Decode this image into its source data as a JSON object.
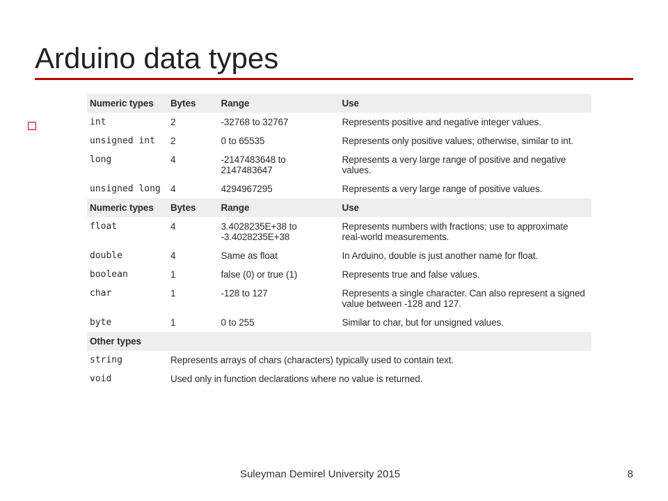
{
  "title": "Arduino data types",
  "headers1": {
    "c1": "Numeric types",
    "c2": "Bytes",
    "c3": "Range",
    "c4": "Use"
  },
  "rows1": [
    {
      "type": "int",
      "bytes": "2",
      "range": "-32768 to 32767",
      "use": "Represents positive and negative integer values."
    },
    {
      "type": "unsigned int",
      "bytes": "2",
      "range": "0 to 65535",
      "use": "Represents only positive values; otherwise, similar to int."
    },
    {
      "type": "long",
      "bytes": "4",
      "range": "-2147483648 to 2147483647",
      "use": "Represents a very large range of positive and negative values."
    },
    {
      "type": "unsigned long",
      "bytes": "4",
      "range": "4294967295",
      "use": "Represents a very large range of positive values."
    }
  ],
  "headers2": {
    "c1": "Numeric types",
    "c2": "Bytes",
    "c3": "Range",
    "c4": "Use"
  },
  "rows2": [
    {
      "type": "float",
      "bytes": "4",
      "range": "3.4028235E+38 to -3.4028235E+38",
      "use": "Represents numbers with fractions; use to approximate real-world measurements."
    },
    {
      "type": "double",
      "bytes": "4",
      "range": "Same as float",
      "use": "In Arduino, double is just another name for float."
    },
    {
      "type": "boolean",
      "bytes": "1",
      "range": "false (0) or true (1)",
      "use": "Represents true and false values."
    },
    {
      "type": "char",
      "bytes": "1",
      "range": "-128 to 127",
      "use": "Represents a single character. Can also represent a signed value between -128 and 127."
    },
    {
      "type": "byte",
      "bytes": "1",
      "range": "0 to 255",
      "use": "Similar to char, but for unsigned values."
    }
  ],
  "headers3": {
    "c1": "Other types"
  },
  "rows3": [
    {
      "type": "string",
      "desc": "Represents arrays of chars (characters) typically used to contain text."
    },
    {
      "type": "void",
      "desc": "Used only in function declarations where no value is returned."
    }
  ],
  "footer": {
    "text": "Suleyman Demirel University 2015",
    "page": "8"
  }
}
